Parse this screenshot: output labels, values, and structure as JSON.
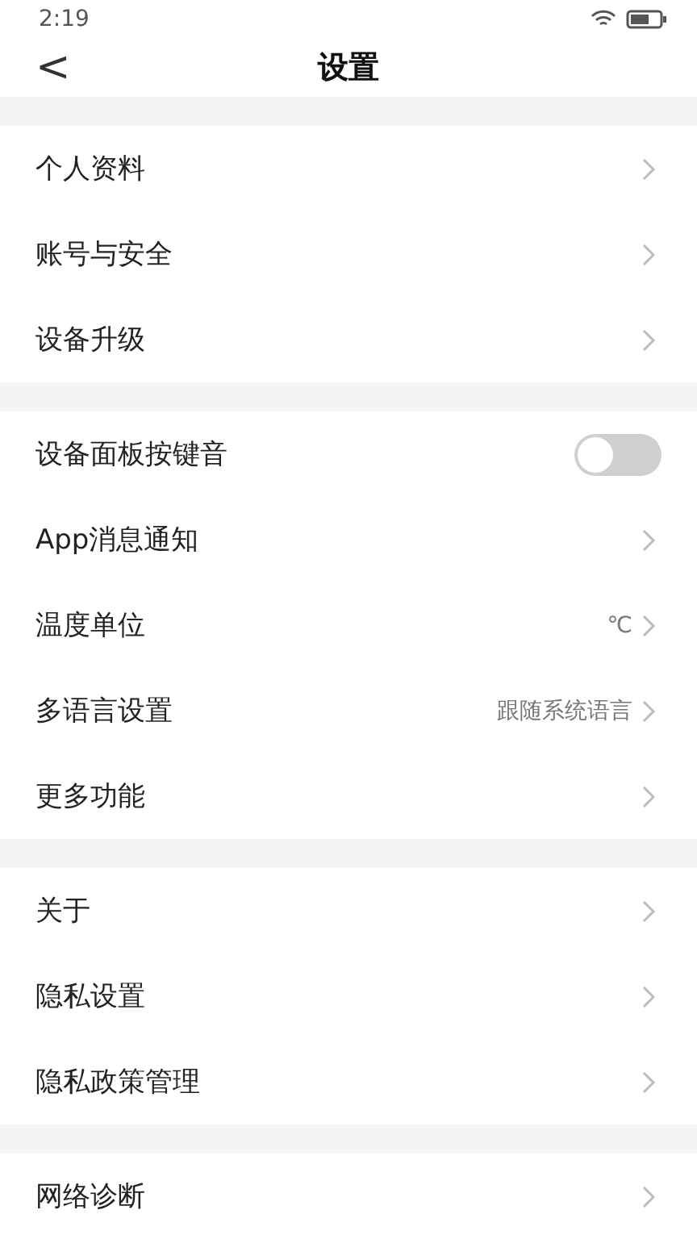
{
  "status_bar": {
    "time": "2:19"
  },
  "header": {
    "back": "<",
    "title": "设置"
  },
  "sections": [
    {
      "items": [
        {
          "kind": "link",
          "label": "个人资料"
        },
        {
          "kind": "link",
          "label": "账号与安全"
        },
        {
          "kind": "link",
          "label": "设备升级"
        }
      ]
    },
    {
      "items": [
        {
          "kind": "switch",
          "label": "设备面板按键音",
          "on": false
        },
        {
          "kind": "link",
          "label": "App消息通知"
        },
        {
          "kind": "link",
          "label": "温度单位",
          "value": "℃"
        },
        {
          "kind": "link",
          "label": "多语言设置",
          "value": "跟随系统语言"
        },
        {
          "kind": "link",
          "label": "更多功能"
        }
      ]
    },
    {
      "items": [
        {
          "kind": "link",
          "label": "关于"
        },
        {
          "kind": "link",
          "label": "隐私设置"
        },
        {
          "kind": "link",
          "label": "隐私政策管理"
        }
      ]
    },
    {
      "items": [
        {
          "kind": "link",
          "label": "网络诊断"
        }
      ]
    }
  ]
}
